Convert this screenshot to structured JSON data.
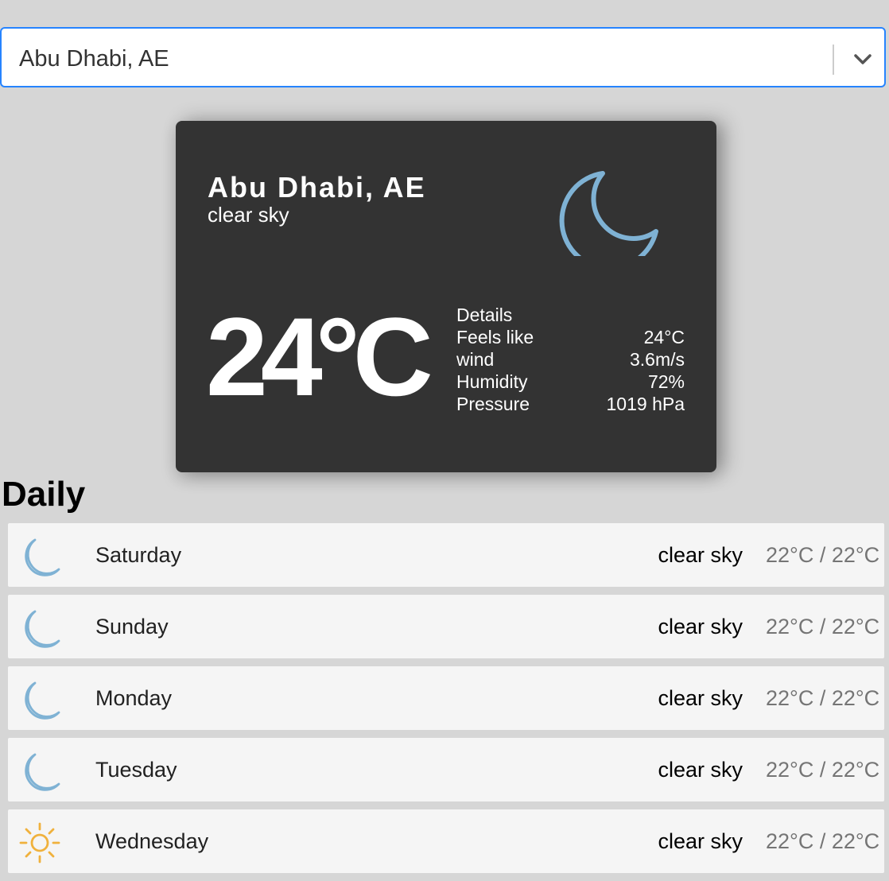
{
  "search": {
    "selected": "Abu Dhabi, AE"
  },
  "current": {
    "city": "Abu Dhabi, AE",
    "description": "clear sky",
    "icon": "moon-icon",
    "temperature": "24°C",
    "details_title": "Details",
    "details": [
      {
        "label": "Feels like",
        "value": "24°C"
      },
      {
        "label": "wind",
        "value": "3.6m/s"
      },
      {
        "label": "Humidity",
        "value": "72%"
      },
      {
        "label": "Pressure",
        "value": "1019 hPa"
      }
    ]
  },
  "daily": {
    "title": "Daily",
    "items": [
      {
        "day": "Saturday",
        "description": "clear sky",
        "temps": "22°C / 22°C",
        "icon": "moon-icon"
      },
      {
        "day": "Sunday",
        "description": "clear sky",
        "temps": "22°C / 22°C",
        "icon": "moon-icon"
      },
      {
        "day": "Monday",
        "description": "clear sky",
        "temps": "22°C / 22°C",
        "icon": "moon-icon"
      },
      {
        "day": "Tuesday",
        "description": "clear sky",
        "temps": "22°C / 22°C",
        "icon": "moon-icon"
      },
      {
        "day": "Wednesday",
        "description": "clear sky",
        "temps": "22°C / 22°C",
        "icon": "sun-icon"
      }
    ]
  },
  "colors": {
    "accent": "#2684ff",
    "card": "#333333",
    "moon": "#7fb2d4",
    "sun": "#f0b13c"
  }
}
